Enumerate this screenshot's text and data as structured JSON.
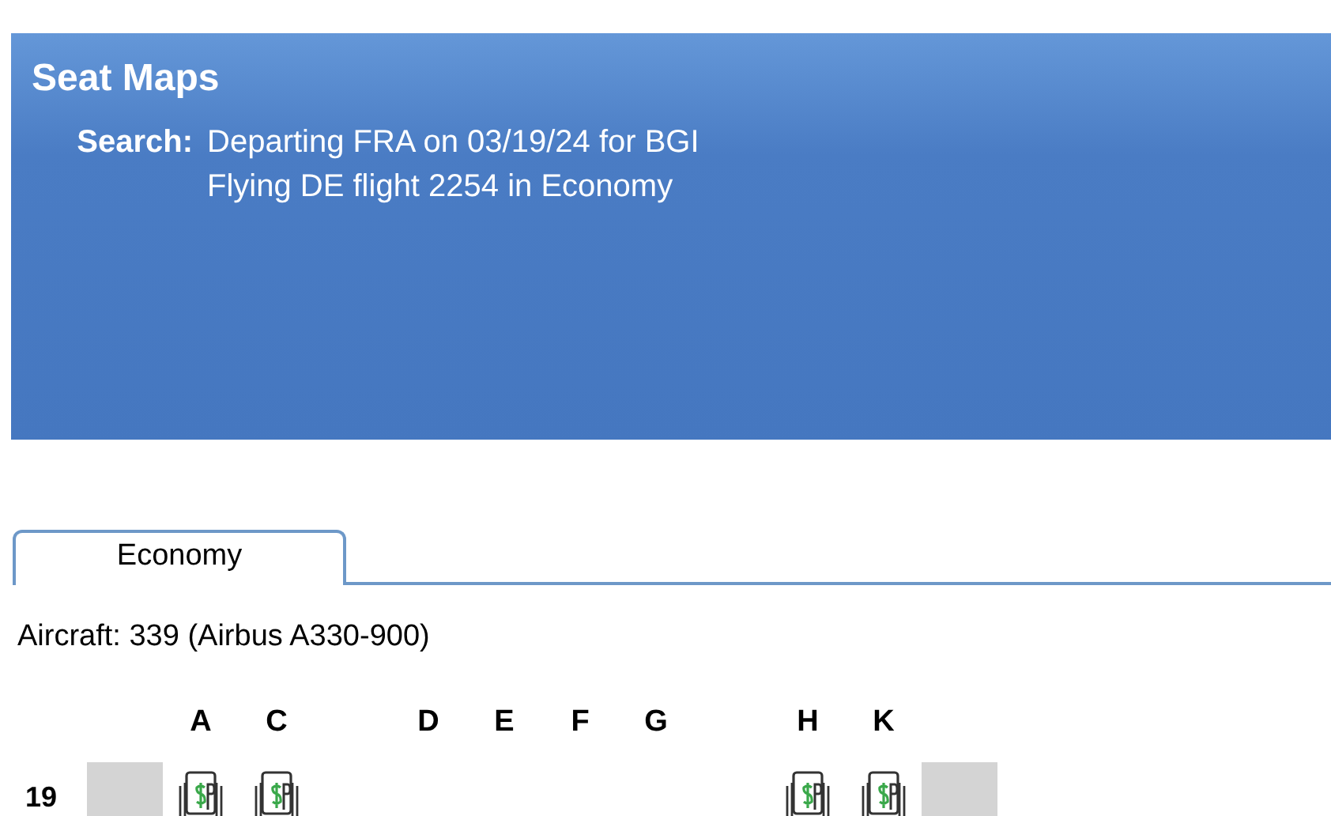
{
  "header": {
    "title": "Seat Maps",
    "search_label": "Search:",
    "search_lines": [
      "Departing FRA on 03/19/24 for BGI",
      "Flying DE flight 2254 in Economy"
    ]
  },
  "tabs": [
    {
      "label": "Economy",
      "selected": true
    }
  ],
  "aircraft": "Aircraft: 339 (Airbus A330-900)",
  "seat_map": {
    "columns": [
      {
        "kind": "wall"
      },
      {
        "kind": "seat",
        "letter": "A"
      },
      {
        "kind": "seat",
        "letter": "C"
      },
      {
        "kind": "aisle"
      },
      {
        "kind": "seat",
        "letter": "D"
      },
      {
        "kind": "seat",
        "letter": "E"
      },
      {
        "kind": "seat",
        "letter": "F"
      },
      {
        "kind": "seat",
        "letter": "G"
      },
      {
        "kind": "aisle"
      },
      {
        "kind": "seat",
        "letter": "H"
      },
      {
        "kind": "seat",
        "letter": "K"
      },
      {
        "kind": "wall"
      }
    ],
    "rows": [
      {
        "number": "19",
        "cells": [
          {
            "kind": "wall"
          },
          {
            "kind": "paid"
          },
          {
            "kind": "paid"
          },
          {
            "kind": "aisle"
          },
          {
            "kind": "empty"
          },
          {
            "kind": "empty"
          },
          {
            "kind": "empty"
          },
          {
            "kind": "empty"
          },
          {
            "kind": "aisle"
          },
          {
            "kind": "paid"
          },
          {
            "kind": "paid"
          },
          {
            "kind": "wall"
          }
        ]
      }
    ]
  }
}
